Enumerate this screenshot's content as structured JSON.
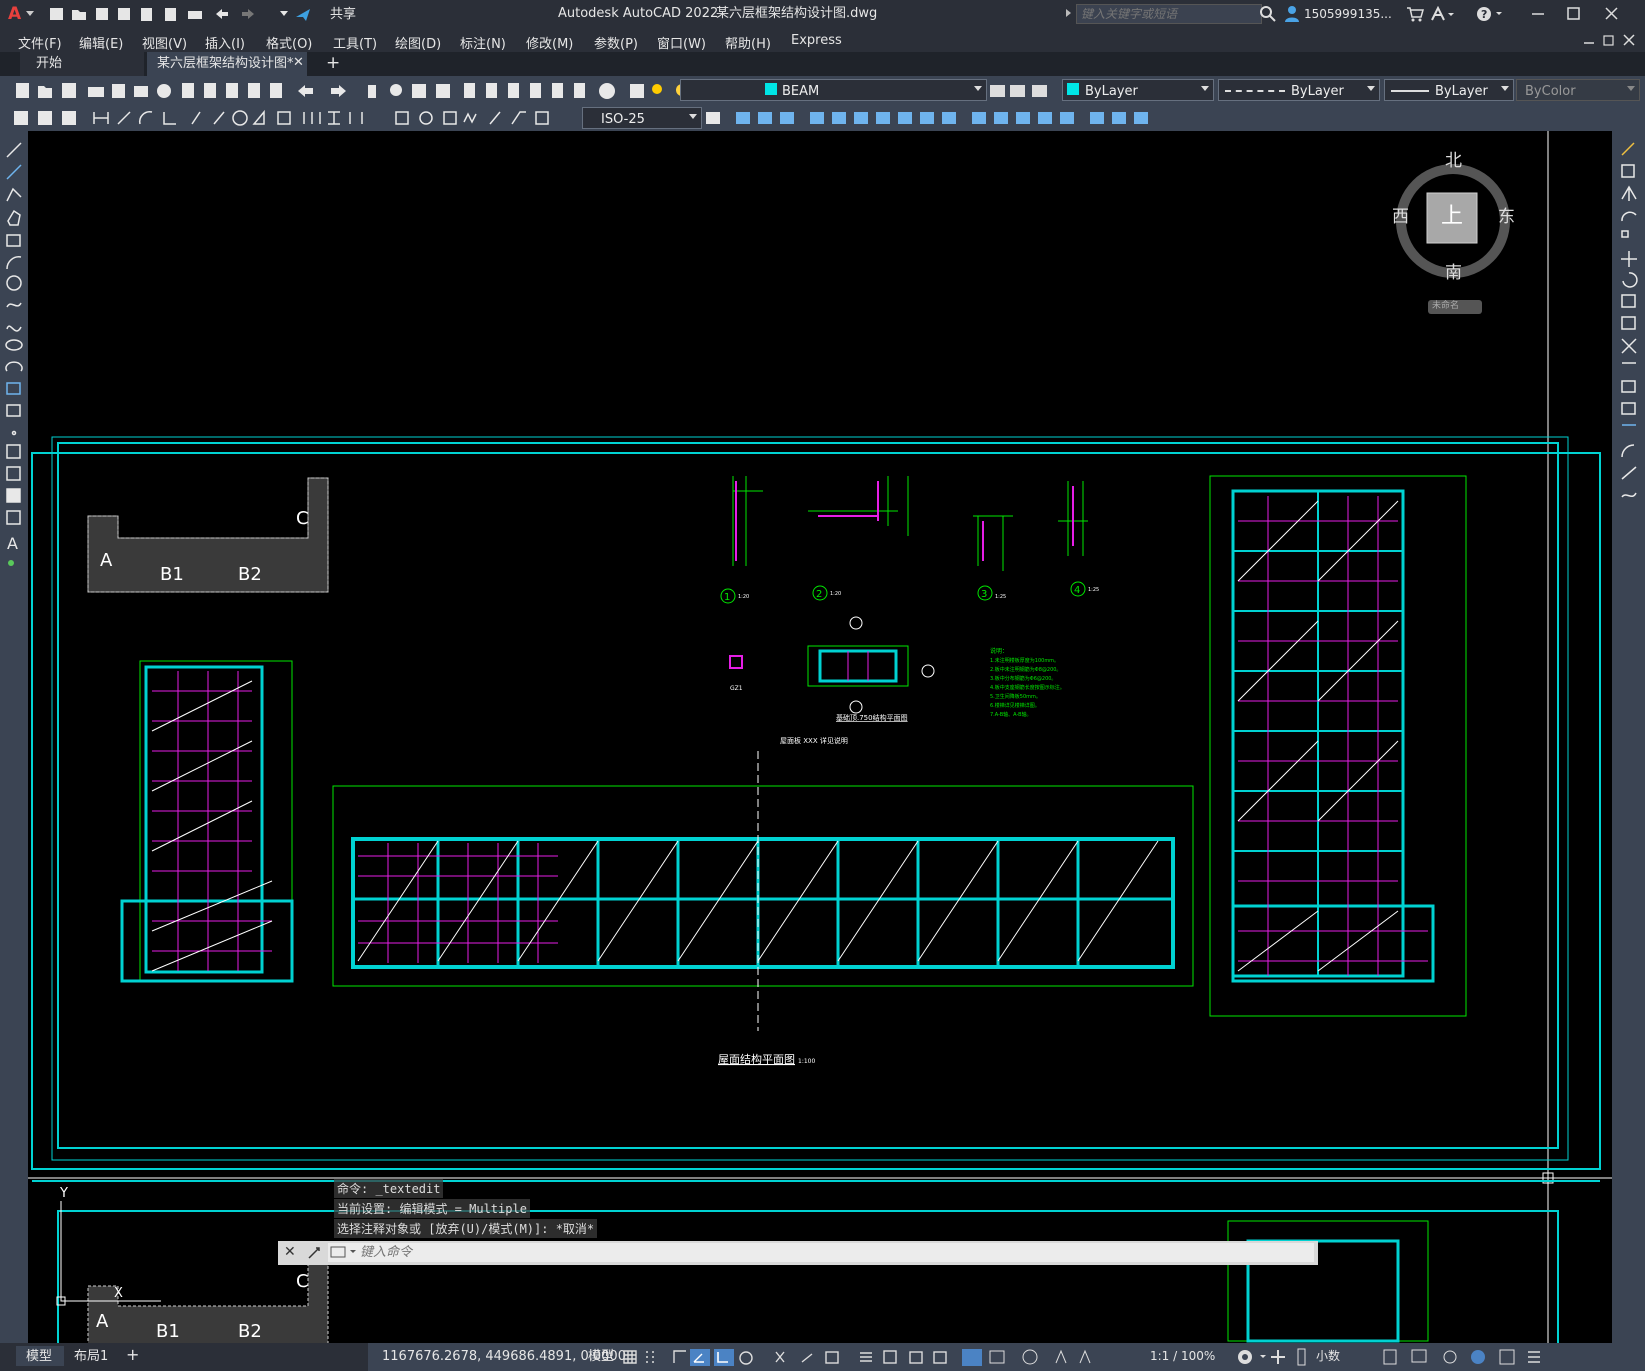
{
  "app": {
    "logo": "A",
    "title": "Autodesk AutoCAD 2022",
    "document": "某六层框架结构设计图.dwg",
    "share_label": "共享"
  },
  "search": {
    "placeholder": "键入关键字或短语"
  },
  "user": {
    "name": "1505999135..."
  },
  "menu": [
    "文件(F)",
    "编辑(E)",
    "视图(V)",
    "插入(I)",
    "格式(O)",
    "工具(T)",
    "绘图(D)",
    "标注(N)",
    "修改(M)",
    "参数(P)",
    "窗口(W)",
    "帮助(H)",
    "Express"
  ],
  "tabs": [
    {
      "label": "开始"
    },
    {
      "label": "某六层框架结构设计图*"
    }
  ],
  "toolbar": {
    "layer": "BEAM",
    "color": "ByLayer",
    "linetype": "ByLayer",
    "lineweight": "ByLayer",
    "plotstyle": "ByColor",
    "dimstyle": "ISO-25"
  },
  "viewcube": {
    "north": "北",
    "south": "南",
    "east": "东",
    "west": "西",
    "top": "上",
    "wcs": "未命名"
  },
  "drawing": {
    "labels_a": [
      "A",
      "B1",
      "B2",
      "C"
    ],
    "title_main": "屋面结构平面图",
    "title_scale": "1:100",
    "section_numbers": [
      "1",
      "2",
      "3",
      "4"
    ],
    "section_scale": [
      "1:20",
      "1:20",
      "1:25",
      "1:25"
    ],
    "plan2_title": "基础顶.750结构平面图",
    "gz_label": "GZ1",
    "notes_title": "说明：",
    "notes": [
      "1.未注明楼板厚度为100mm。",
      "2.板中未注明钢筋为Φ8@200。",
      "3.板中分布钢筋为Φ6@200。",
      "4.板中支座钢筋长度按图示标注。",
      "5.卫生间降板50mm。",
      "6.楼梯详见楼梯详图。",
      "7.A-B轴、A-B轴。"
    ],
    "note_top": "屋面板 XXX 详见说明",
    "axis_y": "Y",
    "axis_x": "X"
  },
  "command": {
    "history": [
      "命令: _textedit",
      "当前设置: 编辑模式 = Multiple",
      "选择注释对象或 [放弃(U)/模式(M)]: *取消*"
    ],
    "placeholder": "键入命令"
  },
  "status": {
    "tab_model": "模型",
    "tab_layout": "布局1",
    "add": "+",
    "coords": "1167676.2678, 449686.4891, 0.0000",
    "space": "模型",
    "scale": "1:1 / 100%",
    "units": "小数"
  },
  "colors": {
    "cyan": "#00d2d2",
    "magenta": "#e61ee6",
    "green": "#00e600",
    "white": "#ffffff"
  }
}
